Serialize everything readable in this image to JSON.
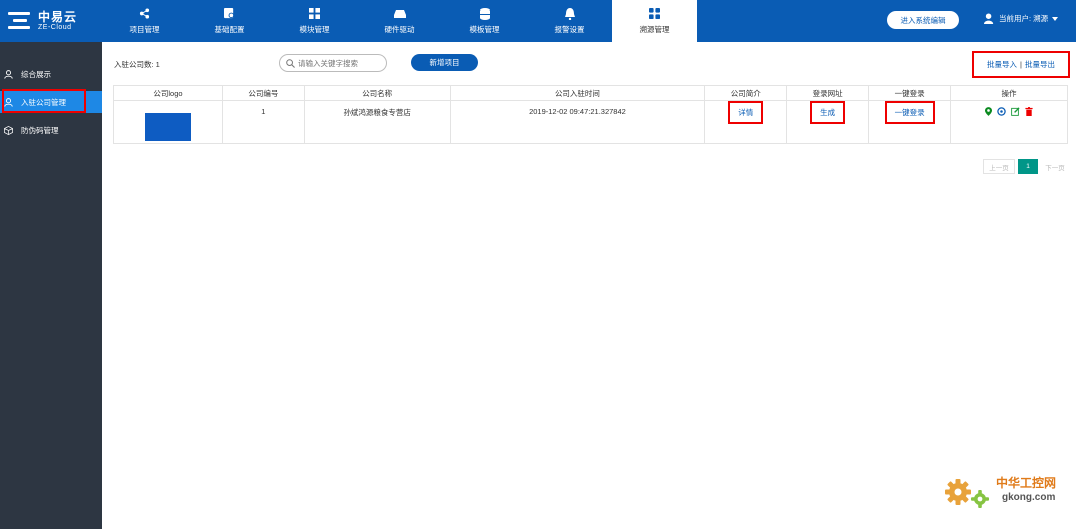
{
  "brand": {
    "name_cn": "中易云",
    "name_en": "ZE-Cloud"
  },
  "nav": [
    {
      "label": "项目管理",
      "icon": "share-nodes-icon",
      "active": false
    },
    {
      "label": "基础配置",
      "icon": "config-gear-icon",
      "active": false
    },
    {
      "label": "模块管理",
      "icon": "modules-grid-icon",
      "active": false
    },
    {
      "label": "硬件驱动",
      "icon": "hard-drive-icon",
      "active": false
    },
    {
      "label": "模板管理",
      "icon": "database-icon",
      "active": false
    },
    {
      "label": "报警设置",
      "icon": "bell-icon",
      "active": false
    },
    {
      "label": "溯源管理",
      "icon": "grid-apps-icon",
      "active": true
    }
  ],
  "header": {
    "system_button": "进入系统编辑",
    "user_label": "当前用户: 溯源"
  },
  "sidebar": [
    {
      "label": "综合展示",
      "icon": "user-icon",
      "active": false
    },
    {
      "label": "入驻公司管理",
      "icon": "user-icon",
      "active": true
    },
    {
      "label": "防伪码管理",
      "icon": "cube-icon",
      "active": false
    }
  ],
  "toolbar": {
    "count_label": "入驻公司数: 1",
    "search_placeholder": "请输入关键字搜索",
    "new_button": "新增项目",
    "batch_import": "批量导入",
    "batch_separator": "|",
    "batch_export": "批量导出"
  },
  "table": {
    "headers": [
      "公司logo",
      "公司编号",
      "公司名称",
      "公司入驻时间",
      "公司简介",
      "登录网址",
      "一键登录",
      "操作"
    ],
    "rows": [
      {
        "id": "1",
        "name": "孙斌鸿源粮食专营店",
        "joined": "2019-12-02 09:47:21.327842",
        "intro": "详情",
        "login_url": "生成",
        "one_click": "一键登录"
      }
    ]
  },
  "pager": {
    "prev": "上一页",
    "current": "1",
    "next": "下一页"
  },
  "watermark": {
    "title": "中华工控网",
    "site": "gkong.com"
  },
  "colors": {
    "primary": "#0a5cb4",
    "sidebar": "#2d3642",
    "sidebar_active": "#1e88e5",
    "highlight": "#e00000",
    "pager_active": "#009688"
  }
}
